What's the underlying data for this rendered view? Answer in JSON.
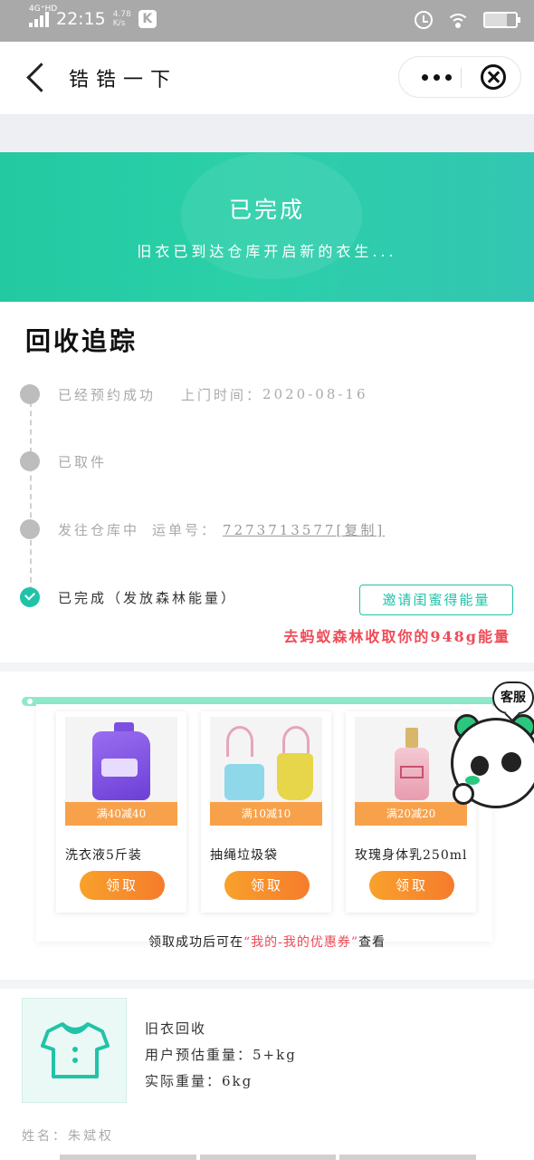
{
  "status_bar": {
    "network": "4G⁺HD",
    "time": "22:15",
    "speed": "4.78",
    "speed_unit": "K/s",
    "app_icon_letter": "K"
  },
  "nav": {
    "title": "锆锆一下",
    "more_icon": "more-dots-icon",
    "close_icon": "close-circle-icon"
  },
  "banner": {
    "title": "已完成",
    "subtitle": "旧衣已到达仓库开启新的衣生..."
  },
  "tracking": {
    "heading": "回收追踪",
    "steps": [
      {
        "label": "已经预约成功",
        "extra_label": "上门时间：",
        "extra_value": "2020-08-16",
        "state": "past"
      },
      {
        "label": "已取件",
        "state": "past"
      },
      {
        "label": "发往仓库中",
        "extra_label": "运单号：",
        "extra_value": "7273713577[复制]",
        "state": "past"
      },
      {
        "label": "已完成（发放森林能量）",
        "state": "current"
      }
    ],
    "invite_button": "邀请闺蜜得能量",
    "energy_text": "去蚂蚁森林收取你的948g能量"
  },
  "coupons": {
    "items": [
      {
        "badge": "满40减40",
        "name": "洗衣液5斤装",
        "claim_label": "领取"
      },
      {
        "badge": "满10减10",
        "name": "抽绳垃圾袋",
        "claim_label": "领取"
      },
      {
        "badge": "满20减20",
        "name": "玫瑰身体乳250ml",
        "claim_label": "领取"
      }
    ],
    "note_prefix": "领取成功后可在",
    "note_highlight": "“我的-我的优惠券”",
    "note_suffix": "查看"
  },
  "customer_service": {
    "label": "客服"
  },
  "order": {
    "icon": "t-shirt-icon",
    "type": "旧衣回收",
    "estimated_weight_label": "用户预估重量：",
    "estimated_weight": "5+kg",
    "actual_weight_label": "实际重量：",
    "actual_weight": "6kg",
    "name_label": "姓名：",
    "name_value": "朱斌权"
  },
  "colors": {
    "accent": "#21c3a8",
    "banner_start": "#22c9a1",
    "energy_red": "#ef4b57",
    "coupon_orange": "#f7a24b"
  }
}
